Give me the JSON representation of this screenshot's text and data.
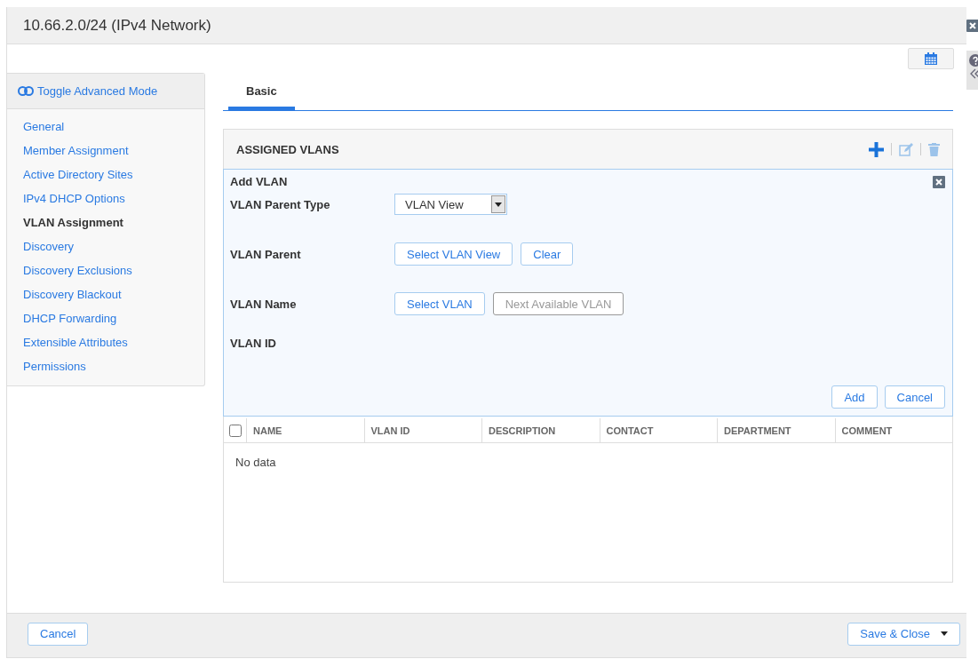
{
  "window": {
    "title": "10.66.2.0/24 (IPv4 Network)"
  },
  "sidebar": {
    "toggle_label": "Toggle Advanced Mode",
    "items": [
      {
        "label": "General",
        "selected": false
      },
      {
        "label": "Member Assignment",
        "selected": false
      },
      {
        "label": "Active Directory Sites",
        "selected": false
      },
      {
        "label": "IPv4 DHCP Options",
        "selected": false
      },
      {
        "label": "VLAN Assignment",
        "selected": true
      },
      {
        "label": "Discovery",
        "selected": false
      },
      {
        "label": "Discovery Exclusions",
        "selected": false
      },
      {
        "label": "Discovery Blackout",
        "selected": false
      },
      {
        "label": "DHCP Forwarding",
        "selected": false
      },
      {
        "label": "Extensible Attributes",
        "selected": false
      },
      {
        "label": "Permissions",
        "selected": false
      }
    ]
  },
  "tabs": [
    {
      "label": "Basic",
      "selected": true
    }
  ],
  "section": {
    "title": "ASSIGNED VLANS"
  },
  "form": {
    "title": "Add VLAN",
    "rows": [
      {
        "kind": "select",
        "label": "VLAN Parent Type",
        "value": "VLAN View"
      },
      {
        "kind": "buttons",
        "label": "VLAN Parent",
        "buttons": [
          {
            "label": "Select VLAN View",
            "disabled": false
          },
          {
            "label": "Clear",
            "disabled": false
          }
        ]
      },
      {
        "kind": "buttons",
        "label": "VLAN Name",
        "buttons": [
          {
            "label": "Select VLAN",
            "disabled": false
          },
          {
            "label": "Next Available VLAN",
            "disabled": true
          }
        ]
      },
      {
        "kind": "text",
        "label": "VLAN ID"
      }
    ],
    "actions": [
      "Add",
      "Cancel"
    ]
  },
  "table": {
    "select_all_checked": false,
    "columns": [
      "NAME",
      "VLAN ID",
      "DESCRIPTION",
      "CONTACT",
      "DEPARTMENT",
      "COMMENT"
    ],
    "empty_message": "No data"
  },
  "footer": {
    "cancel": "Cancel",
    "save": "Save & Close"
  }
}
